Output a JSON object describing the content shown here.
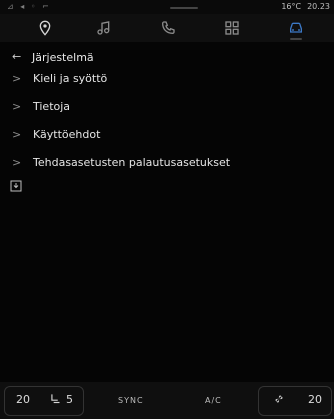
{
  "status": {
    "temperature": "16°C",
    "time": "20.23"
  },
  "nav": {
    "items": [
      {
        "name": "navigation",
        "icon": "location-pin-icon"
      },
      {
        "name": "music",
        "icon": "music-note-icon"
      },
      {
        "name": "phone",
        "icon": "phone-icon"
      },
      {
        "name": "apps",
        "icon": "grid-icon"
      },
      {
        "name": "vehicle",
        "icon": "car-icon"
      }
    ]
  },
  "page": {
    "title": "Järjestelmä"
  },
  "menu": {
    "items": [
      {
        "label": "Kieli ja syöttö"
      },
      {
        "label": "Tietoja"
      },
      {
        "label": "Käyttöehdot"
      },
      {
        "label": "Tehdasasetusten palautusasetukset"
      }
    ]
  },
  "climate": {
    "left_temp": "20",
    "fan_level": "5",
    "sync": "SYNC",
    "ac": "A/C",
    "right_temp": "20"
  }
}
